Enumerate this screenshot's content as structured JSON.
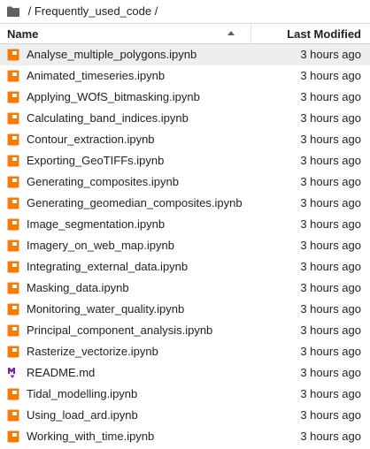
{
  "breadcrumb": {
    "icon": "folder-icon",
    "text": " / Frequently_used_code / "
  },
  "header": {
    "name_label": "Name",
    "sort_icon": "caret-up-icon",
    "modified_label": "Last Modified"
  },
  "colors": {
    "notebook_icon": "#f57c00",
    "markdown_icon": "#7b1fa2",
    "selected_row": "#eeeeee"
  },
  "files": [
    {
      "name": "Analyse_multiple_polygons.ipynb",
      "modified": "3 hours ago",
      "icon": "notebook-icon",
      "selected": true
    },
    {
      "name": "Animated_timeseries.ipynb",
      "modified": "3 hours ago",
      "icon": "notebook-icon"
    },
    {
      "name": "Applying_WOfS_bitmasking.ipynb",
      "modified": "3 hours ago",
      "icon": "notebook-icon"
    },
    {
      "name": "Calculating_band_indices.ipynb",
      "modified": "3 hours ago",
      "icon": "notebook-icon"
    },
    {
      "name": "Contour_extraction.ipynb",
      "modified": "3 hours ago",
      "icon": "notebook-icon"
    },
    {
      "name": "Exporting_GeoTIFFs.ipynb",
      "modified": "3 hours ago",
      "icon": "notebook-icon"
    },
    {
      "name": "Generating_composites.ipynb",
      "modified": "3 hours ago",
      "icon": "notebook-icon"
    },
    {
      "name": "Generating_geomedian_composites.ipynb",
      "modified": "3 hours ago",
      "icon": "notebook-icon"
    },
    {
      "name": "Image_segmentation.ipynb",
      "modified": "3 hours ago",
      "icon": "notebook-icon"
    },
    {
      "name": "Imagery_on_web_map.ipynb",
      "modified": "3 hours ago",
      "icon": "notebook-icon"
    },
    {
      "name": "Integrating_external_data.ipynb",
      "modified": "3 hours ago",
      "icon": "notebook-icon"
    },
    {
      "name": "Masking_data.ipynb",
      "modified": "3 hours ago",
      "icon": "notebook-icon"
    },
    {
      "name": "Monitoring_water_quality.ipynb",
      "modified": "3 hours ago",
      "icon": "notebook-icon"
    },
    {
      "name": "Principal_component_analysis.ipynb",
      "modified": "3 hours ago",
      "icon": "notebook-icon"
    },
    {
      "name": "Rasterize_vectorize.ipynb",
      "modified": "3 hours ago",
      "icon": "notebook-icon"
    },
    {
      "name": "README.md",
      "modified": "3 hours ago",
      "icon": "markdown-icon"
    },
    {
      "name": "Tidal_modelling.ipynb",
      "modified": "3 hours ago",
      "icon": "notebook-icon"
    },
    {
      "name": "Using_load_ard.ipynb",
      "modified": "3 hours ago",
      "icon": "notebook-icon"
    },
    {
      "name": "Working_with_time.ipynb",
      "modified": "3 hours ago",
      "icon": "notebook-icon"
    }
  ]
}
